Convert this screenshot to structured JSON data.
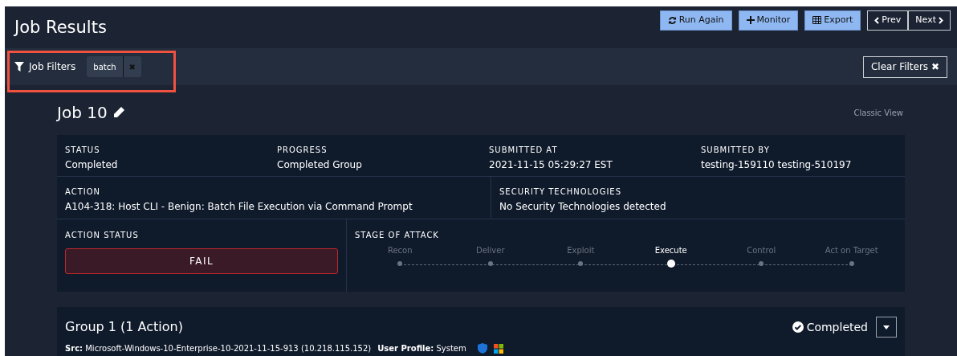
{
  "header": {
    "title": "Job Results",
    "buttons": [
      {
        "label": "Run Again",
        "kind": "primary"
      },
      {
        "label": "Monitor",
        "kind": "primary"
      },
      {
        "label": "Export",
        "kind": "primary"
      }
    ],
    "pager": [
      {
        "label": "Prev",
        "kind": "prev"
      },
      {
        "label": "Next",
        "kind": "next"
      }
    ]
  },
  "filters": {
    "label": "Job Filters",
    "tags": [
      {
        "label": "batch",
        "remove": "✖"
      }
    ],
    "clear_button": "Clear Filters ✖"
  },
  "job": {
    "title": "Job 10",
    "classic_view": "Classic View"
  },
  "details": [
    {
      "label": "STATUS",
      "value": "Completed"
    },
    {
      "label": "PROGRESS",
      "value": "Completed Group"
    },
    {
      "label": "SUBMITTED AT",
      "value": "2021-11-15 05:29:27 EST"
    },
    {
      "label": "SUBMITTED BY",
      "value": "testing-159110 testing-510197"
    },
    {
      "label": "ACTION",
      "value": "A104-318: Host CLI - Benign: Batch File Execution via Command Prompt"
    },
    {
      "label": "SECURITY TECHNOLOGIES",
      "value": "No Security Technologies detected"
    }
  ],
  "action_status": {
    "label": "ACTION STATUS",
    "value": "FAIL"
  },
  "stage_of_attack": {
    "label": "STAGE OF ATTACK",
    "stages": [
      {
        "label": "Recon",
        "selected": false
      },
      {
        "label": "Deliver",
        "selected": false
      },
      {
        "label": "Exploit",
        "selected": false
      },
      {
        "label": "Execute",
        "selected": true
      },
      {
        "label": "Control",
        "selected": false
      },
      {
        "label": "Act on Target",
        "selected": false
      }
    ]
  },
  "group": {
    "title": "Group 1 (1 Action)",
    "status": "Completed",
    "src": "**Src:** Microsoft-Windows-10-Enterprise-10-2021-11-15-913 (10.218.115.152)",
    "user_profile": "**User Profile:** System"
  }
}
